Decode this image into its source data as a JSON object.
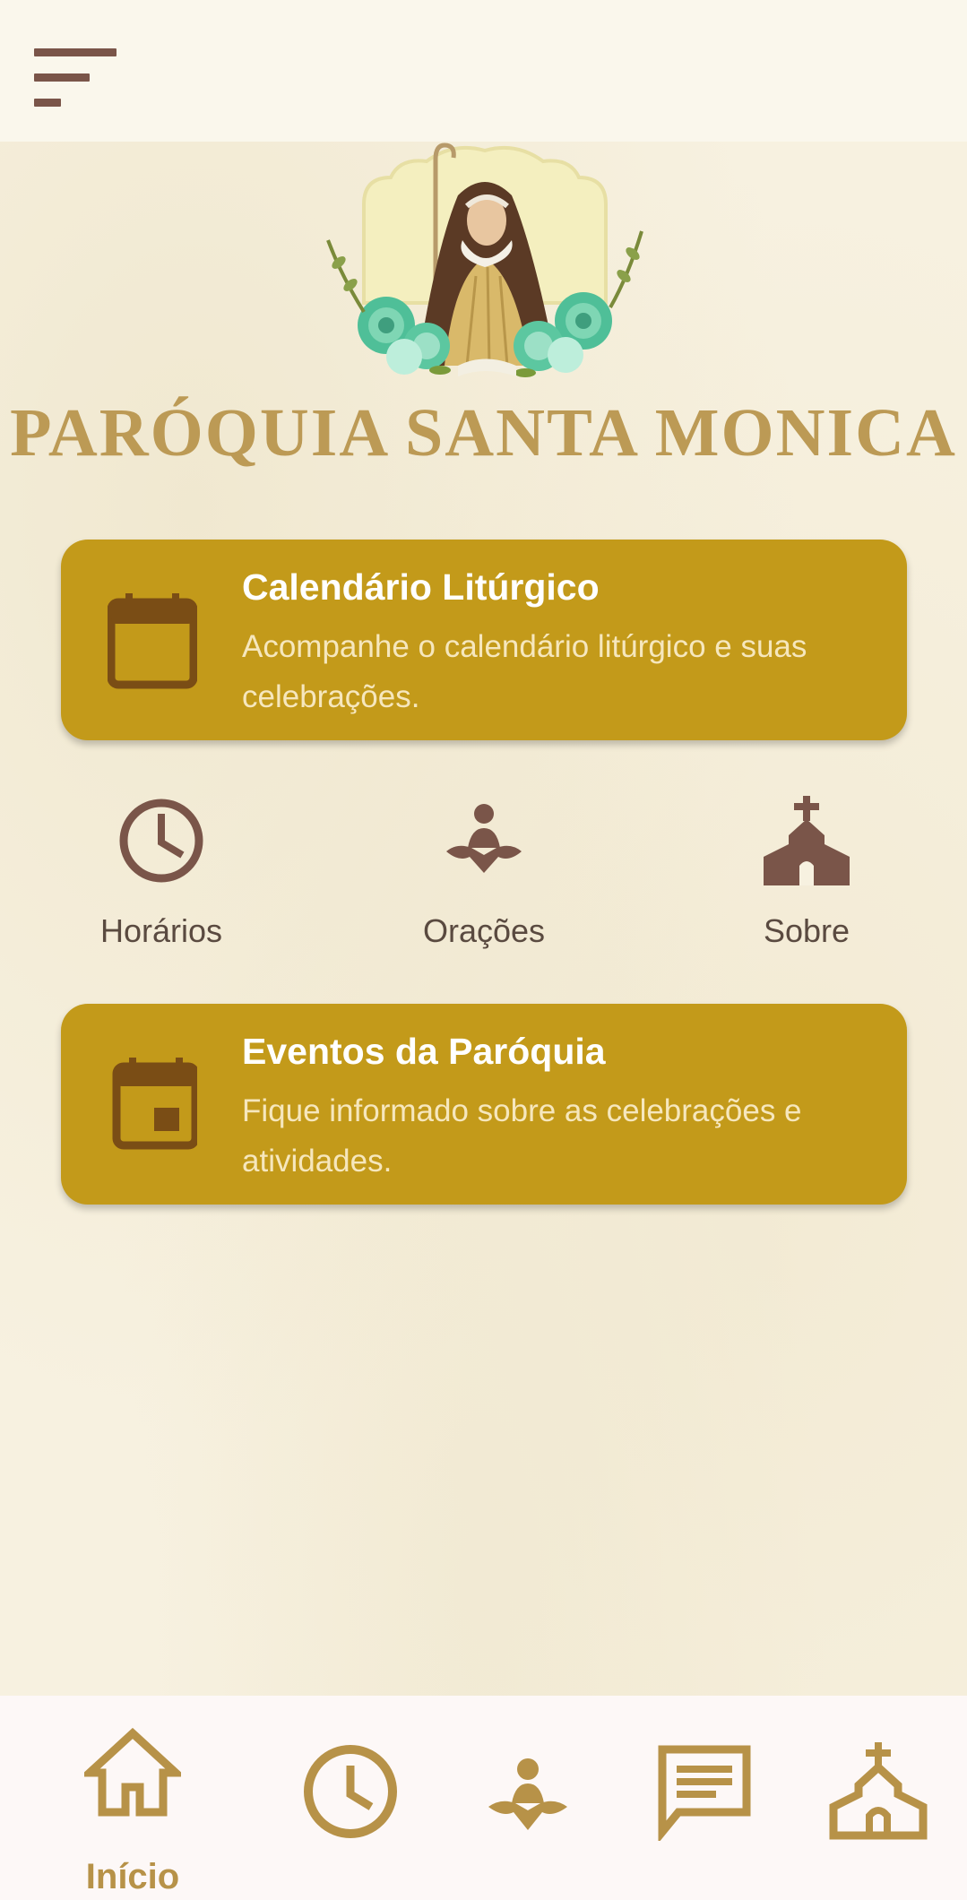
{
  "header": {
    "menu_icon": "menu-icon",
    "title": "PARÓQUIA SANTA MONICA"
  },
  "cards": [
    {
      "icon": "calendar-icon",
      "title": "Calendário Litúrgico",
      "description": "Acompanhe o calendário litúrgico e suas celebrações."
    },
    {
      "icon": "event-icon",
      "title": "Eventos da Paróquia",
      "description": "Fique informado sobre as celebrações e atividades."
    }
  ],
  "quick_links": [
    {
      "icon": "clock-icon",
      "label": "Horários"
    },
    {
      "icon": "meditation-icon",
      "label": "Orações"
    },
    {
      "icon": "church-icon",
      "label": "Sobre"
    }
  ],
  "bottom_nav": {
    "items": [
      {
        "icon": "home-icon",
        "label": "Início",
        "active": true
      },
      {
        "icon": "clock-icon",
        "label": ""
      },
      {
        "icon": "meditation-icon",
        "label": ""
      },
      {
        "icon": "chat-icon",
        "label": ""
      },
      {
        "icon": "church-icon",
        "label": ""
      }
    ]
  },
  "colors": {
    "card_bg": "#c39a1a",
    "icon_brown": "#7a5549",
    "nav_gold": "#b79248",
    "title_gold": "#bc9a55"
  }
}
